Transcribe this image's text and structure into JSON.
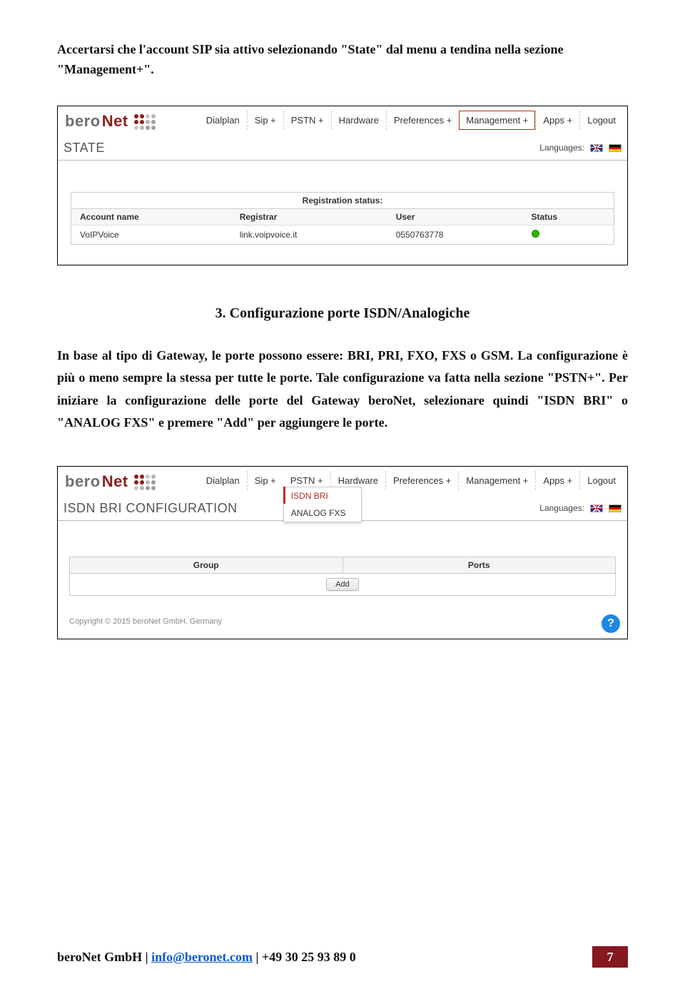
{
  "intro_text": "Accertarsi che l'account SIP sia attivo selezionando \"State\" dal menu a tendina nella sezione \"Management+\".",
  "section_heading": "3. Configurazione porte ISDN/Analogiche",
  "body_text": "In base al tipo di Gateway, le porte possono essere: BRI, PRI, FXO, FXS o GSM. La configurazione è più o meno sempre la stessa per tutte le porte. Tale configurazione va fatta nella sezione \"PSTN+\". Per iniziare la configurazione delle porte del Gateway beroNet, selezionare quindi \"ISDN BRI\" o \"ANALOG FXS\" e premere \"Add\" per aggiungere le porte.",
  "logo": {
    "bero": "bero",
    "net": "Net"
  },
  "nav": {
    "dialplan": "Dialplan",
    "sip": "Sip +",
    "pstn": "PSTN +",
    "hardware": "Hardware",
    "preferences": "Preferences +",
    "management": "Management +",
    "apps": "Apps +",
    "logout": "Logout"
  },
  "languages_label": "Languages:",
  "screenshot1": {
    "page_title": "STATE",
    "reg_title": "Registration status:",
    "columns": {
      "account": "Account name",
      "registrar": "Registrar",
      "user": "User",
      "status": "Status"
    },
    "row": {
      "account": "VoIPVoice",
      "registrar": "link.voipvoice.it",
      "user": "0550763778"
    }
  },
  "screenshot2": {
    "page_title": "ISDN BRI CONFIGURATION",
    "dropdown": {
      "isdn": "ISDN BRI",
      "analog": "ANALOG FXS"
    },
    "ports_columns": {
      "group": "Group",
      "ports": "Ports"
    },
    "add_label": "Add",
    "copyright": "Copyright © 2015 beroNet GmbH, Germany",
    "help": "?"
  },
  "footer": {
    "company": "beroNet GmbH",
    "email": "info@beronet.com",
    "phone": "+49 30 25 93 89 0",
    "sep": " | ",
    "page": "7"
  }
}
